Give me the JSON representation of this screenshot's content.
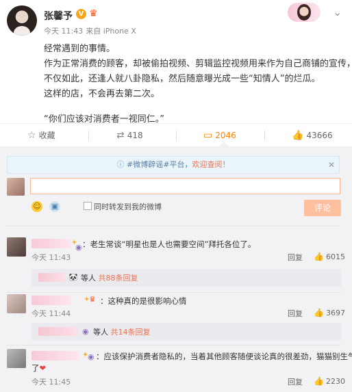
{
  "post": {
    "author": "张馨予",
    "verified_mark": "V",
    "time": "今天 11:43",
    "source": "来自 iPhone X",
    "lines": [
      "经常遇到的事情。",
      "作为正常消费的顾客，却被偷拍视频、剪辑监控视频用来作为自己商铺的宣传，",
      "不仅如此，还逢人就八卦隐私，然后随意曝光成一些“知情人”的烂瓜。",
      "这样的店，不会再去第二次。"
    ],
    "quote": "“你们应该对消费者一视同仁。”"
  },
  "actions": {
    "favorite_label": "收藏",
    "repost_count": "418",
    "comment_count": "2046",
    "like_count": "43666"
  },
  "comment_box": {
    "notice_prefix": "#微博辟谣#平台，",
    "notice_link": "欢迎查阅！",
    "repost_option": "同时转发到我的微博",
    "submit_label": "评论"
  },
  "comments": [
    {
      "text": "：老生常谈“明星也是人也需要空间”拜托各位了。",
      "time": "今天 11:43",
      "reply_label": "回复",
      "likes": "6015",
      "sub_prefix": "等人",
      "sub_link": "共88条回复"
    },
    {
      "text": "：这种真的是很影响心情",
      "time": "今天 11:44",
      "reply_label": "回复",
      "likes": "3697",
      "sub_prefix": "等人",
      "sub_link": "共14条回复"
    },
    {
      "text": "：应该保护消费者隐私的，当着其他顾客随便谈论真的很差劲，猫猫别生气",
      "text2": "了",
      "time": "今天 11:45",
      "reply_label": "回复",
      "likes": "2230"
    }
  ],
  "colors": {
    "accent": "#ff8200",
    "link": "#eb7350",
    "panel_bg": "#f2f2f5"
  }
}
